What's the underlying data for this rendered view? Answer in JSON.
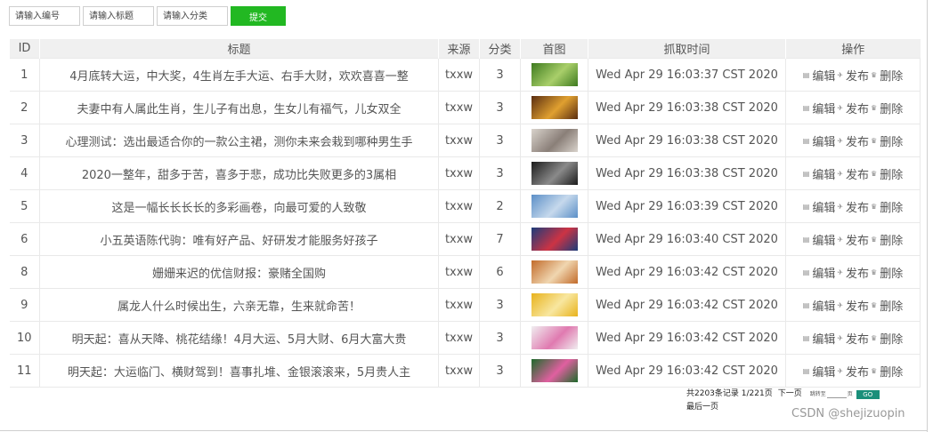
{
  "filters": {
    "id_placeholder": "请输入编号",
    "title_placeholder": "请输入标题",
    "category_placeholder": "请输入分类",
    "submit_label": "提交"
  },
  "table": {
    "headers": [
      "ID",
      "标题",
      "来源",
      "分类",
      "首图",
      "抓取时间",
      "操作"
    ],
    "rows": [
      {
        "id": "1",
        "title": "4月底转大运，中大奖，4生肖左手大运、右手大财，欢欢喜喜一整",
        "source": "txxw",
        "category": "3",
        "time": "Wed Apr 29 16:03:37 CST 2020"
      },
      {
        "id": "2",
        "title": "夫妻中有人属此生肖，生儿子有出息，生女儿有福气，儿女双全",
        "source": "txxw",
        "category": "3",
        "time": "Wed Apr 29 16:03:38 CST 2020"
      },
      {
        "id": "3",
        "title": "心理测试：选出最适合你的一款公主裙，测你未来会栽到哪种男生手",
        "source": "txxw",
        "category": "3",
        "time": "Wed Apr 29 16:03:38 CST 2020"
      },
      {
        "id": "4",
        "title": "2020一整年，甜多于苦，喜多于悲，成功比失败更多的3属相",
        "source": "txxw",
        "category": "3",
        "time": "Wed Apr 29 16:03:38 CST 2020"
      },
      {
        "id": "5",
        "title": "这是一幅长长长长的多彩画卷，向最可爱的人致敬",
        "source": "txxw",
        "category": "2",
        "time": "Wed Apr 29 16:03:39 CST 2020"
      },
      {
        "id": "6",
        "title": "小五英语陈代驹：唯有好产品、好研发才能服务好孩子",
        "source": "txxw",
        "category": "7",
        "time": "Wed Apr 29 16:03:40 CST 2020"
      },
      {
        "id": "8",
        "title": "姗姗来迟的优信财报：豪赌全国购",
        "source": "txxw",
        "category": "6",
        "time": "Wed Apr 29 16:03:42 CST 2020"
      },
      {
        "id": "9",
        "title": "属龙人什么时候出生，六亲无靠，生来就命苦！",
        "source": "txxw",
        "category": "3",
        "time": "Wed Apr 29 16:03:42 CST 2020"
      },
      {
        "id": "10",
        "title": "明天起：喜从天降、桃花结缘！4月大运、5月大财、6月大富大贵",
        "source": "txxw",
        "category": "3",
        "time": "Wed Apr 29 16:03:42 CST 2020"
      },
      {
        "id": "11",
        "title": "明天起：大运临门、横财驾到！喜事扎堆、金银滚滚来，5月贵人主",
        "source": "txxw",
        "category": "3",
        "time": "Wed Apr 29 16:03:42 CST 2020"
      }
    ],
    "ops": {
      "edit": "编辑",
      "publish": "发布",
      "delete": "删除"
    }
  },
  "thumb_colors": [
    [
      "#3e7a1f",
      "#a9cf6a"
    ],
    [
      "#5a2d10",
      "#e0a030"
    ],
    [
      "#d9d3cc",
      "#8a7f78"
    ],
    [
      "#1b1b1b",
      "#8a8a8a"
    ],
    [
      "#5b8fc7",
      "#c6d9ec"
    ],
    [
      "#1c3c7a",
      "#cc3344"
    ],
    [
      "#c26b2a",
      "#f0d6b0"
    ],
    [
      "#e8b21c",
      "#f8e7a0"
    ],
    [
      "#f0eef0",
      "#e07ab0"
    ],
    [
      "#1d6a2a",
      "#e060a0"
    ]
  ],
  "pagination": {
    "summary": "共2203条记录  1/221页",
    "next": "下一页",
    "last": "最后一页",
    "jump_label": "跳转至",
    "page_unit": "页",
    "go_label": "GO"
  },
  "watermark": "CSDN @shejizuopin"
}
